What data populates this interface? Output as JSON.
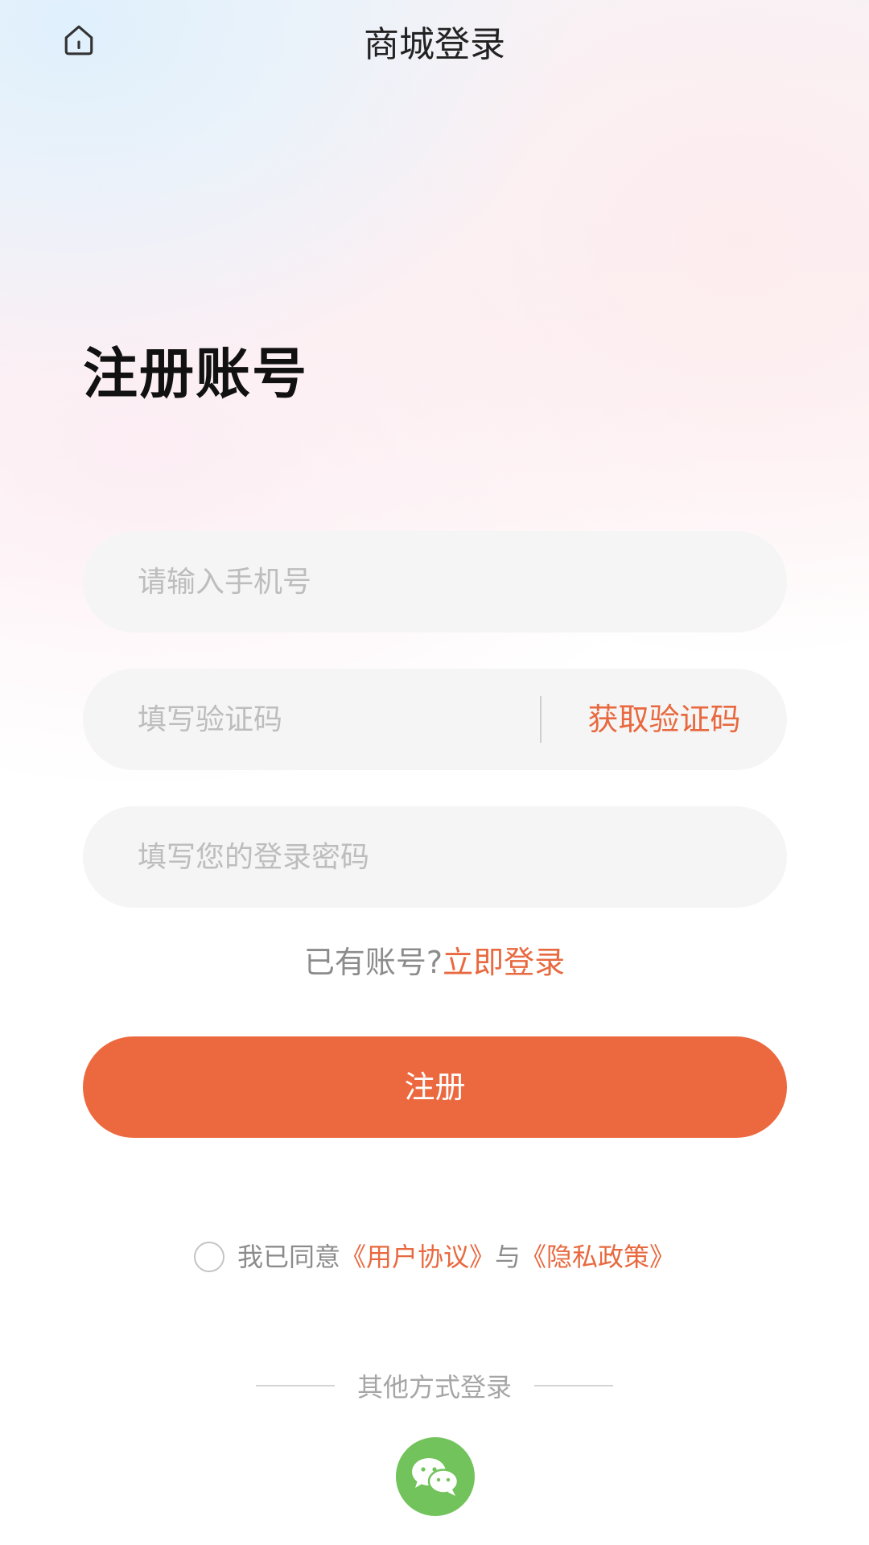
{
  "header": {
    "title": "商城登录",
    "home_icon": "home-icon"
  },
  "heading": "注册账号",
  "form": {
    "phone_placeholder": "请输入手机号",
    "code_placeholder": "填写验证码",
    "get_code_label": "获取验证码",
    "password_placeholder": "填写您的登录密码"
  },
  "login_prompt": {
    "text": "已有账号?",
    "link": "立即登录"
  },
  "register_label": "注册",
  "agreement": {
    "prefix": "我已同意",
    "user_agreement": "《用户协议》",
    "conjunction": "与",
    "privacy_policy": "《隐私政策》",
    "checked": false
  },
  "other_login": {
    "label": "其他方式登录",
    "wechat_icon": "wechat-icon"
  },
  "colors": {
    "accent": "#ec693f",
    "link": "#e8693f",
    "wechat": "#72c35b",
    "input_bg": "#f5f5f5"
  }
}
